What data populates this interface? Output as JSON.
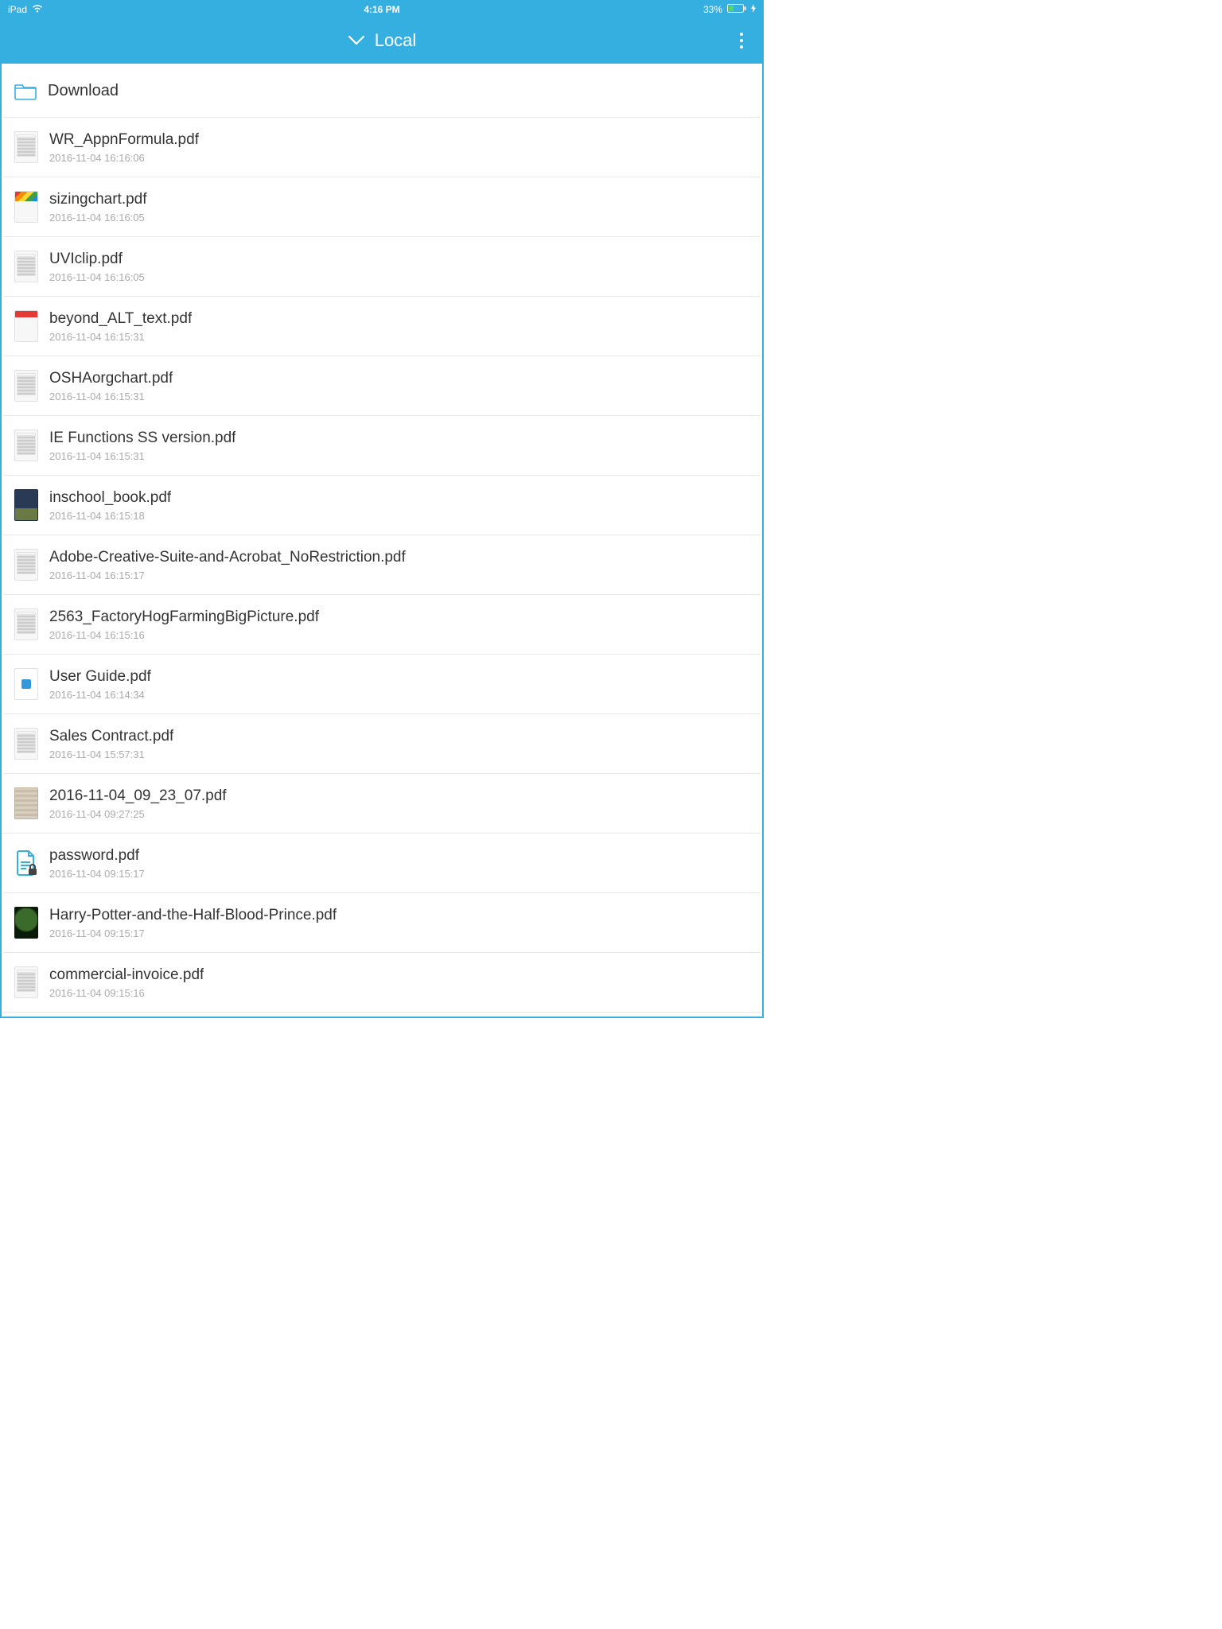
{
  "statusBar": {
    "device": "iPad",
    "time": "4:16 PM",
    "batteryText": "33%"
  },
  "navBar": {
    "title": "Local"
  },
  "folder": {
    "name": "Download"
  },
  "files": [
    {
      "name": "WR_AppnFormula.pdf",
      "date": "2016-11-04 16:16:06",
      "thumb": "plain"
    },
    {
      "name": "sizingchart.pdf",
      "date": "2016-11-04 16:16:05",
      "thumb": "rainbow"
    },
    {
      "name": "UVIclip.pdf",
      "date": "2016-11-04 16:16:05",
      "thumb": "plain"
    },
    {
      "name": "beyond_ALT_text.pdf",
      "date": "2016-11-04 16:15:31",
      "thumb": "redtop"
    },
    {
      "name": "OSHAorgchart.pdf",
      "date": "2016-11-04 16:15:31",
      "thumb": "plain"
    },
    {
      "name": "IE Functions SS version.pdf",
      "date": "2016-11-04 16:15:31",
      "thumb": "plain"
    },
    {
      "name": "inschool_book.pdf",
      "date": "2016-11-04 16:15:18",
      "thumb": "photo1"
    },
    {
      "name": "Adobe-Creative-Suite-and-Acrobat_NoRestriction.pdf",
      "date": "2016-11-04 16:15:17",
      "thumb": "plain"
    },
    {
      "name": "2563_FactoryHogFarmingBigPicture.pdf",
      "date": "2016-11-04 16:15:16",
      "thumb": "plain"
    },
    {
      "name": "User Guide.pdf",
      "date": "2016-11-04 16:14:34",
      "thumb": "blueicon"
    },
    {
      "name": "Sales Contract.pdf",
      "date": "2016-11-04 15:57:31",
      "thumb": "plain"
    },
    {
      "name": "2016-11-04_09_23_07.pdf",
      "date": "2016-11-04 09:27:25",
      "thumb": "photo2"
    },
    {
      "name": "password.pdf",
      "date": "2016-11-04 09:15:17",
      "thumb": "pdflock"
    },
    {
      "name": "Harry-Potter-and-the-Half-Blood-Prince.pdf",
      "date": "2016-11-04 09:15:17",
      "thumb": "photo3"
    },
    {
      "name": "commercial-invoice.pdf",
      "date": "2016-11-04 09:15:16",
      "thumb": "plain"
    }
  ]
}
